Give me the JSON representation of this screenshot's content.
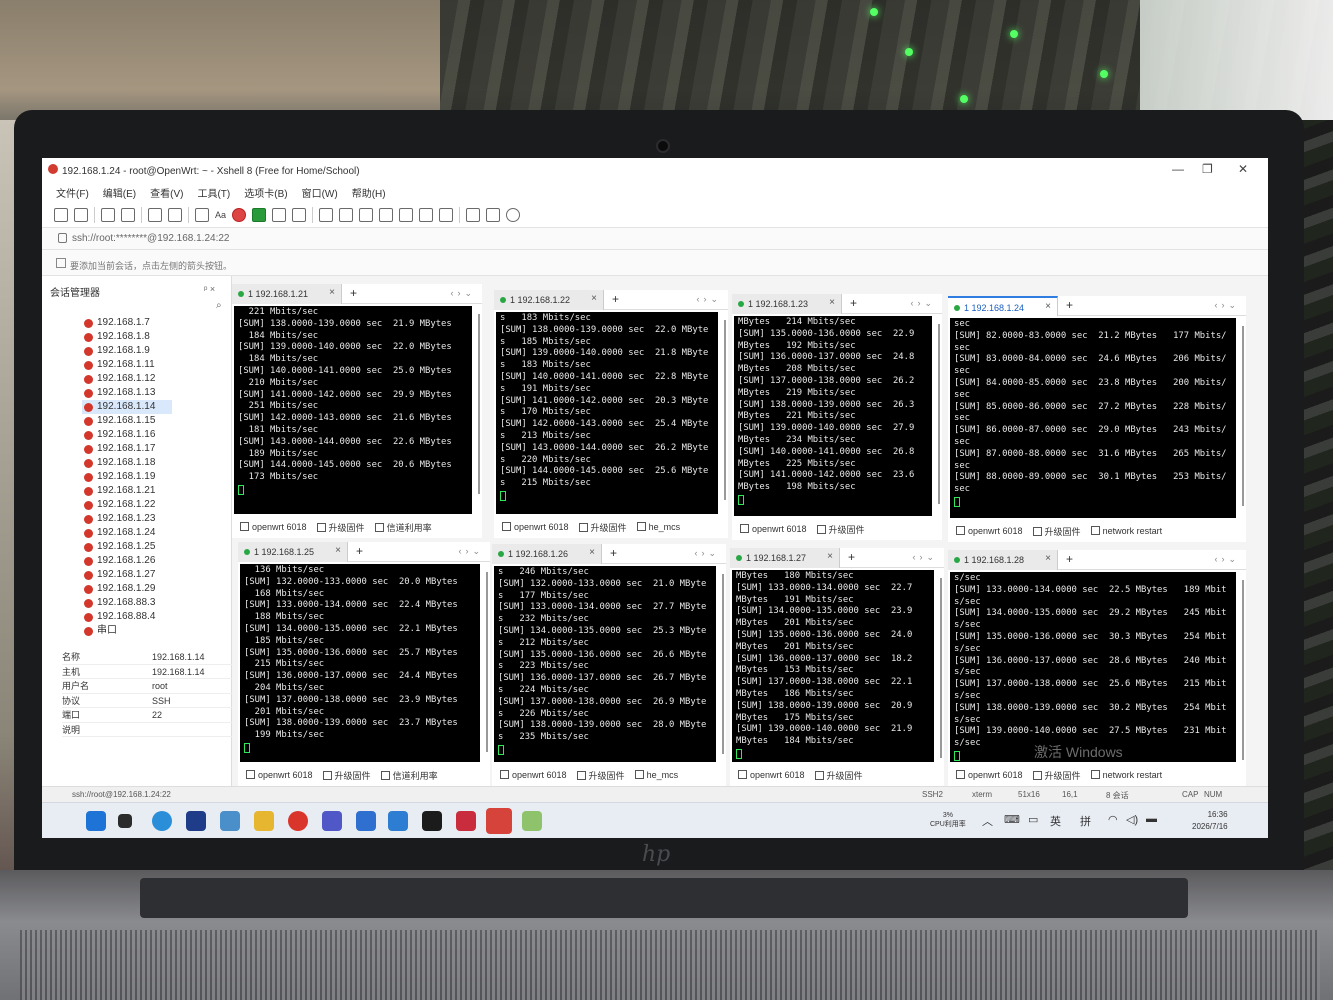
{
  "window": {
    "title": "192.168.1.24 - root@OpenWrt: ~ - Xshell 8 (Free for Home/School)",
    "min": "—",
    "max": "❐",
    "close": "✕"
  },
  "menu": [
    "文件(F)",
    "编辑(E)",
    "查看(V)",
    "工具(T)",
    "选项卡(B)",
    "窗口(W)",
    "帮助(H)"
  ],
  "toolbar": {
    "font_label": "Aa"
  },
  "address": "ssh://root:********@192.168.1.24:22",
  "hint": "要添加当前会话，点击左侧的箭头按钮。",
  "sidebar": {
    "title": "会话管理器",
    "pin": "ᵖ ×",
    "hosts": [
      "192.168.1.7",
      "192.168.1.8",
      "192.168.1.9",
      "192.168.1.11",
      "192.168.1.12",
      "192.168.1.13",
      "192.168.1.14",
      "192.168.1.15",
      "192.168.1.16",
      "192.168.1.17",
      "192.168.1.18",
      "192.168.1.19",
      "192.168.1.21",
      "192.168.1.22",
      "192.168.1.23",
      "192.168.1.24",
      "192.168.1.25",
      "192.168.1.26",
      "192.168.1.27",
      "192.168.1.29",
      "192.168.88.3",
      "192.168.88.4",
      "串口"
    ],
    "selected": "192.168.1.14",
    "props": [
      {
        "k": "名称",
        "v": "192.168.1.14"
      },
      {
        "k": "主机",
        "v": "192.168.1.14"
      },
      {
        "k": "用户名",
        "v": "root"
      },
      {
        "k": "协议",
        "v": "SSH"
      },
      {
        "k": "端口",
        "v": "22"
      },
      {
        "k": "说明",
        "v": ""
      }
    ]
  },
  "panes": [
    {
      "tab": "1 192.168.1.21",
      "lines": [
        "  221 Mbits/sec",
        "[SUM] 138.0000-139.0000 sec  21.9 MBytes",
        "  184 Mbits/sec",
        "[SUM] 139.0000-140.0000 sec  22.0 MBytes",
        "  184 Mbits/sec",
        "[SUM] 140.0000-141.0000 sec  25.0 MBytes",
        "  210 Mbits/sec",
        "[SUM] 141.0000-142.0000 sec  29.9 MBytes",
        "  251 Mbits/sec",
        "[SUM] 142.0000-143.0000 sec  21.6 MBytes",
        "  181 Mbits/sec",
        "[SUM] 143.0000-144.0000 sec  22.6 MBytes",
        "  189 Mbits/sec",
        "[SUM] 144.0000-145.0000 sec  20.6 MBytes",
        "  173 Mbits/sec"
      ],
      "quick": [
        "openwrt 6018",
        "升级固件",
        "信道利用率"
      ]
    },
    {
      "tab": "1 192.168.1.22",
      "lines": [
        "s   183 Mbits/sec",
        "[SUM] 138.0000-139.0000 sec  22.0 MByte",
        "s   185 Mbits/sec",
        "[SUM] 139.0000-140.0000 sec  21.8 MByte",
        "s   183 Mbits/sec",
        "[SUM] 140.0000-141.0000 sec  22.8 MByte",
        "s   191 Mbits/sec",
        "[SUM] 141.0000-142.0000 sec  20.3 MByte",
        "s   170 Mbits/sec",
        "[SUM] 142.0000-143.0000 sec  25.4 MByte",
        "s   213 Mbits/sec",
        "[SUM] 143.0000-144.0000 sec  26.2 MByte",
        "s   220 Mbits/sec",
        "[SUM] 144.0000-145.0000 sec  25.6 MByte",
        "s   215 Mbits/sec"
      ],
      "quick": [
        "openwrt 6018",
        "升级固件",
        "he_mcs"
      ]
    },
    {
      "tab": "1 192.168.1.23",
      "lines": [
        "MBytes   214 Mbits/sec",
        "[SUM] 135.0000-136.0000 sec  22.9",
        "MBytes   192 Mbits/sec",
        "[SUM] 136.0000-137.0000 sec  24.8",
        "MBytes   208 Mbits/sec",
        "[SUM] 137.0000-138.0000 sec  26.2",
        "MBytes   219 Mbits/sec",
        "[SUM] 138.0000-139.0000 sec  26.3",
        "MBytes   221 Mbits/sec",
        "[SUM] 139.0000-140.0000 sec  27.9",
        "MBytes   234 Mbits/sec",
        "[SUM] 140.0000-141.0000 sec  26.8",
        "MBytes   225 Mbits/sec",
        "[SUM] 141.0000-142.0000 sec  23.6",
        "MBytes   198 Mbits/sec"
      ],
      "quick": [
        "openwrt 6018",
        "升级固件"
      ]
    },
    {
      "tab": "1 192.168.1.24",
      "lines": [
        "sec",
        "[SUM] 82.0000-83.0000 sec  21.2 MBytes   177 Mbits/",
        "sec",
        "[SUM] 83.0000-84.0000 sec  24.6 MBytes   206 Mbits/",
        "sec",
        "[SUM] 84.0000-85.0000 sec  23.8 MBytes   200 Mbits/",
        "sec",
        "[SUM] 85.0000-86.0000 sec  27.2 MBytes   228 Mbits/",
        "sec",
        "[SUM] 86.0000-87.0000 sec  29.0 MBytes   243 Mbits/",
        "sec",
        "[SUM] 87.0000-88.0000 sec  31.6 MBytes   265 Mbits/",
        "sec",
        "[SUM] 88.0000-89.0000 sec  30.1 MBytes   253 Mbits/",
        "sec"
      ],
      "quick": [
        "openwrt 6018",
        "升级固件",
        "network restart"
      ]
    },
    {
      "tab": "1 192.168.1.25",
      "lines": [
        "  136 Mbits/sec",
        "[SUM] 132.0000-133.0000 sec  20.0 MBytes",
        "  168 Mbits/sec",
        "[SUM] 133.0000-134.0000 sec  22.4 MBytes",
        "  188 Mbits/sec",
        "[SUM] 134.0000-135.0000 sec  22.1 MBytes",
        "  185 Mbits/sec",
        "[SUM] 135.0000-136.0000 sec  25.7 MBytes",
        "  215 Mbits/sec",
        "[SUM] 136.0000-137.0000 sec  24.4 MBytes",
        "  204 Mbits/sec",
        "[SUM] 137.0000-138.0000 sec  23.9 MBytes",
        "  201 Mbits/sec",
        "[SUM] 138.0000-139.0000 sec  23.7 MBytes",
        "  199 Mbits/sec"
      ],
      "quick": [
        "openwrt 6018",
        "升级固件",
        "信道利用率"
      ]
    },
    {
      "tab": "1 192.168.1.26",
      "lines": [
        "s   246 Mbits/sec",
        "[SUM] 132.0000-133.0000 sec  21.0 MByte",
        "s   177 Mbits/sec",
        "[SUM] 133.0000-134.0000 sec  27.7 MByte",
        "s   232 Mbits/sec",
        "[SUM] 134.0000-135.0000 sec  25.3 MByte",
        "s   212 Mbits/sec",
        "[SUM] 135.0000-136.0000 sec  26.6 MByte",
        "s   223 Mbits/sec",
        "[SUM] 136.0000-137.0000 sec  26.7 MByte",
        "s   224 Mbits/sec",
        "[SUM] 137.0000-138.0000 sec  26.9 MByte",
        "s   226 Mbits/sec",
        "[SUM] 138.0000-139.0000 sec  28.0 MByte",
        "s   235 Mbits/sec"
      ],
      "quick": [
        "openwrt 6018",
        "升级固件",
        "he_mcs"
      ]
    },
    {
      "tab": "1 192.168.1.27",
      "lines": [
        "MBytes   180 Mbits/sec",
        "[SUM] 133.0000-134.0000 sec  22.7",
        "MBytes   191 Mbits/sec",
        "[SUM] 134.0000-135.0000 sec  23.9",
        "MBytes   201 Mbits/sec",
        "[SUM] 135.0000-136.0000 sec  24.0",
        "MBytes   201 Mbits/sec",
        "[SUM] 136.0000-137.0000 sec  18.2",
        "MBytes   153 Mbits/sec",
        "[SUM] 137.0000-138.0000 sec  22.1",
        "MBytes   186 Mbits/sec",
        "[SUM] 138.0000-139.0000 sec  20.9",
        "MBytes   175 Mbits/sec",
        "[SUM] 139.0000-140.0000 sec  21.9",
        "MBytes   184 Mbits/sec"
      ],
      "quick": [
        "openwrt 6018",
        "升级固件"
      ]
    },
    {
      "tab": "1 192.168.1.28",
      "lines": [
        "s/sec",
        "[SUM] 133.0000-134.0000 sec  22.5 MBytes   189 Mbit",
        "s/sec",
        "[SUM] 134.0000-135.0000 sec  29.2 MBytes   245 Mbit",
        "s/sec",
        "[SUM] 135.0000-136.0000 sec  30.3 MBytes   254 Mbit",
        "s/sec",
        "[SUM] 136.0000-137.0000 sec  28.6 MBytes   240 Mbit",
        "s/sec",
        "[SUM] 137.0000-138.0000 sec  25.6 MBytes   215 Mbit",
        "s/sec",
        "[SUM] 138.0000-139.0000 sec  30.2 MBytes   254 Mbit",
        "s/sec",
        "[SUM] 139.0000-140.0000 sec  27.5 MBytes   231 Mbit",
        "s/sec"
      ],
      "quick": [
        "openwrt 6018",
        "升级固件",
        "network restart"
      ]
    }
  ],
  "status": {
    "left": "ssh://root@192.168.1.24:22",
    "proto": "SSH2",
    "term": "xterm",
    "size": "51x16",
    "pos": "16,1",
    "sessions": "8 会话",
    "caps": "CAP",
    "num": "NUM"
  },
  "watermark": "激活 Windows",
  "taskbar": {
    "cpu": "CPU利用率",
    "cpu_val": "3%",
    "ime1": "英",
    "ime2": "拼",
    "time": "16:36",
    "date": "2026/7/16"
  },
  "brand": "hp"
}
